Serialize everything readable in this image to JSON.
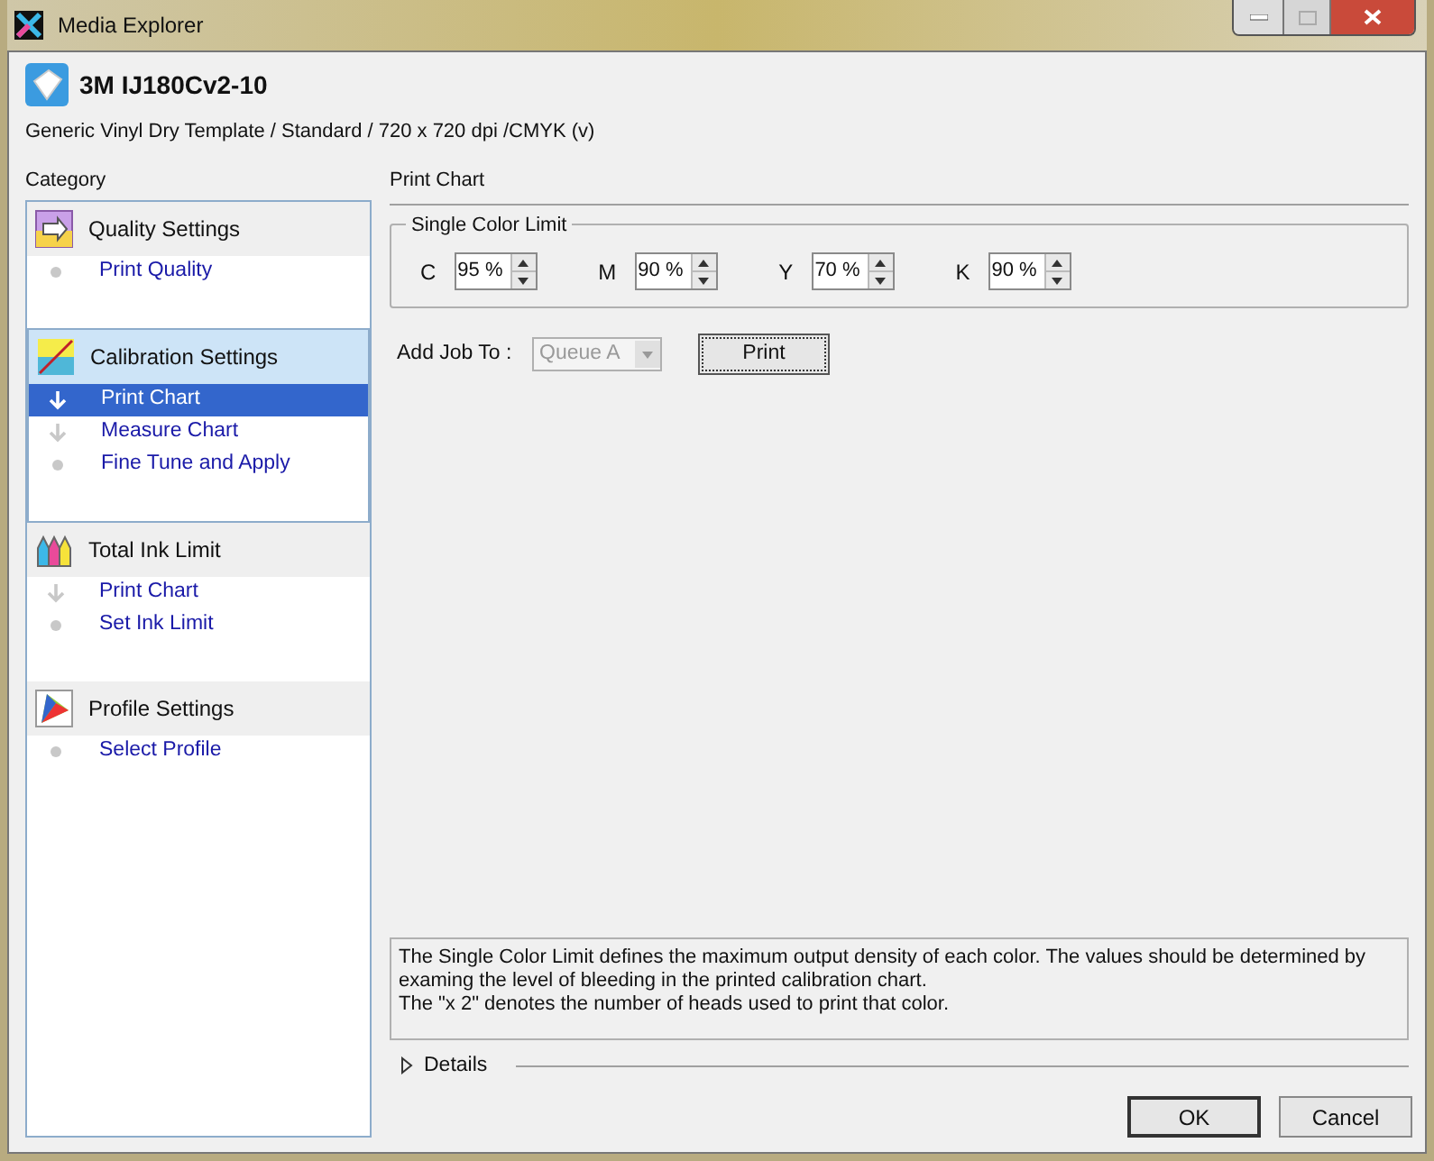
{
  "window": {
    "title": "Media Explorer"
  },
  "media": {
    "name": "3M IJ180Cv2-10",
    "description": "Generic Vinyl Dry Template / Standard / 720 x 720 dpi /CMYK (v)"
  },
  "sidebar": {
    "heading": "Category",
    "groups": [
      {
        "kind": "quality",
        "label": "Quality Settings",
        "active": false,
        "items": [
          {
            "label": "Print Quality",
            "kind": "dot",
            "selected": false
          }
        ]
      },
      {
        "kind": "calibration",
        "label": "Calibration Settings",
        "active": true,
        "items": [
          {
            "label": "Print Chart",
            "kind": "arrow",
            "selected": true
          },
          {
            "label": "Measure Chart",
            "kind": "arrow",
            "selected": false
          },
          {
            "label": "Fine Tune and Apply",
            "kind": "dot",
            "selected": false
          }
        ]
      },
      {
        "kind": "ink",
        "label": "Total Ink Limit",
        "active": false,
        "items": [
          {
            "label": "Print Chart",
            "kind": "arrow",
            "selected": false
          },
          {
            "label": "Set Ink Limit",
            "kind": "dot",
            "selected": false
          }
        ]
      },
      {
        "kind": "profile",
        "label": "Profile Settings",
        "active": false,
        "items": [
          {
            "label": "Select Profile",
            "kind": "dot",
            "selected": false
          }
        ]
      }
    ]
  },
  "main": {
    "heading": "Print Chart",
    "limit_group": {
      "title": "Single Color Limit",
      "channels": [
        {
          "label": "C",
          "value": "95 %"
        },
        {
          "label": "M",
          "value": "90 %"
        },
        {
          "label": "Y",
          "value": "70 %"
        },
        {
          "label": "K",
          "value": "90 %"
        }
      ]
    },
    "add_job": {
      "label": "Add Job To :",
      "queue": "Queue A",
      "queue_disabled": true,
      "print_button": "Print"
    },
    "description": [
      "The Single Color Limit defines the maximum output density of each color. The values should be determined by examing the level of bleeding in the printed calibration chart.",
      "The \"x 2\" denotes the number of heads used to print that color."
    ],
    "details": {
      "label": "Details",
      "expanded": false
    }
  },
  "buttons": [
    {
      "label": "OK",
      "default": true
    },
    {
      "label": "Cancel",
      "default": false
    }
  ]
}
